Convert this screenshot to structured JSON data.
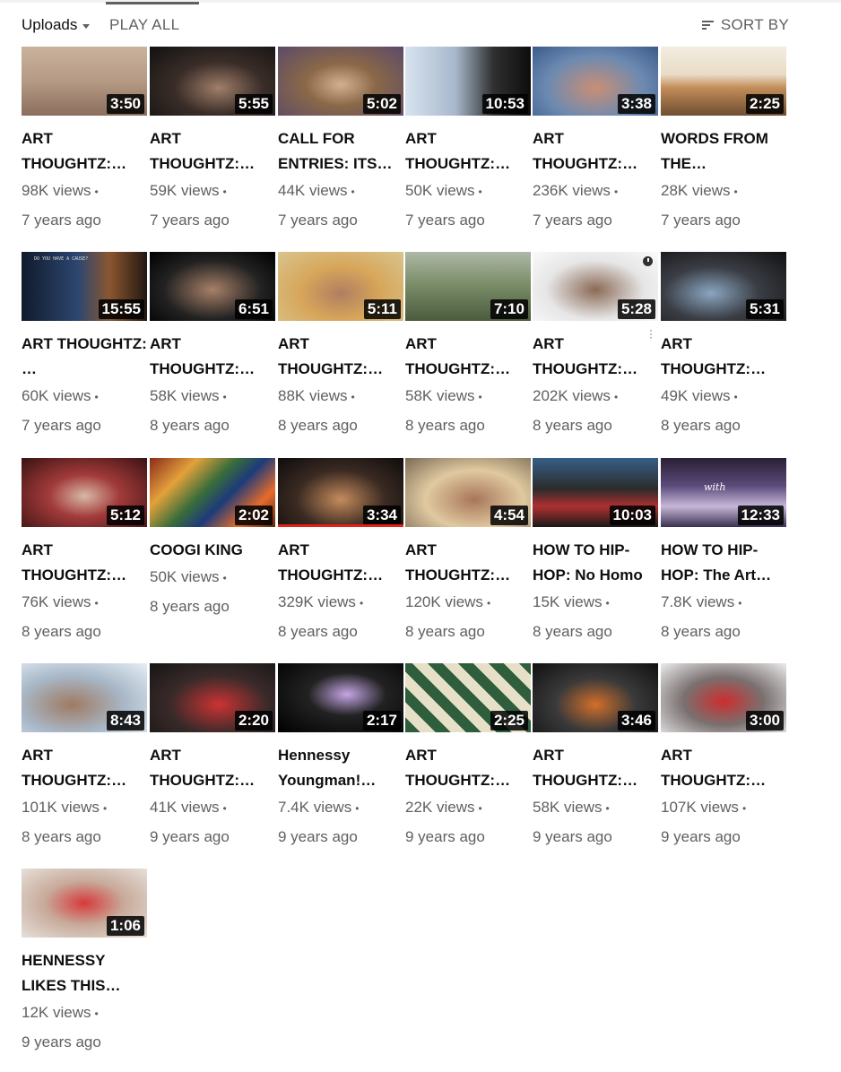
{
  "toolbar": {
    "uploads_label": "Uploads",
    "play_all_label": "PLAY ALL",
    "sort_by_label": "SORT BY"
  },
  "colors": {
    "text": "#0f0f0f",
    "secondary": "#606060",
    "progress": "#e62117"
  },
  "videos": [
    {
      "title": "ART THOUGHTZ:…",
      "duration": "3:50",
      "views": "98K views",
      "age": "7 years ago"
    },
    {
      "title": "ART THOUGHTZ:…",
      "duration": "5:55",
      "views": "59K views",
      "age": "7 years ago"
    },
    {
      "title": "CALL FOR ENTRIES: ITS…",
      "duration": "5:02",
      "views": "44K views",
      "age": "7 years ago"
    },
    {
      "title": "ART THOUGHTZ:…",
      "duration": "10:53",
      "views": "50K views",
      "age": "7 years ago"
    },
    {
      "title": "ART THOUGHTZ:…",
      "duration": "3:38",
      "views": "236K views",
      "age": "7 years ago"
    },
    {
      "title": "WORDS FROM THE…",
      "duration": "2:25",
      "views": "28K views",
      "age": "7 years ago"
    },
    {
      "title": "ART THOUGHTZ: …",
      "duration": "15:55",
      "views": "60K views",
      "age": "7 years ago",
      "thumb_text": "DO YOU HAVE A CAUSE?"
    },
    {
      "title": "ART THOUGHTZ:…",
      "duration": "6:51",
      "views": "58K views",
      "age": "8 years ago"
    },
    {
      "title": "ART THOUGHTZ:…",
      "duration": "5:11",
      "views": "88K views",
      "age": "8 years ago"
    },
    {
      "title": "ART THOUGHTZ:…",
      "duration": "7:10",
      "views": "58K views",
      "age": "8 years ago"
    },
    {
      "title": "ART THOUGHTZ:…",
      "duration": "5:28",
      "views": "202K views",
      "age": "8 years ago"
    },
    {
      "title": "ART THOUGHTZ:…",
      "duration": "5:31",
      "views": "49K views",
      "age": "8 years ago"
    },
    {
      "title": "ART THOUGHTZ:…",
      "duration": "5:12",
      "views": "76K views",
      "age": "8 years ago"
    },
    {
      "title": "COOGI KING",
      "duration": "2:02",
      "views": "50K views",
      "age": "8 years ago"
    },
    {
      "title": "ART THOUGHTZ:…",
      "duration": "3:34",
      "views": "329K views",
      "age": "8 years ago"
    },
    {
      "title": "ART THOUGHTZ:…",
      "duration": "4:54",
      "views": "120K views",
      "age": "8 years ago"
    },
    {
      "title": "HOW TO HIP-HOP: No Homo",
      "duration": "10:03",
      "views": "15K views",
      "age": "8 years ago"
    },
    {
      "title": "HOW TO HIP-HOP: The Art…",
      "duration": "12:33",
      "views": "7.8K views",
      "age": "8 years ago",
      "thumb_text": "with"
    },
    {
      "title": "ART THOUGHTZ:…",
      "duration": "8:43",
      "views": "101K views",
      "age": "8 years ago"
    },
    {
      "title": "ART THOUGHTZ:…",
      "duration": "2:20",
      "views": "41K views",
      "age": "9 years ago"
    },
    {
      "title": "Hennessy Youngman!…",
      "duration": "2:17",
      "views": "7.4K views",
      "age": "9 years ago"
    },
    {
      "title": "ART THOUGHTZ:…",
      "duration": "2:25",
      "views": "22K views",
      "age": "9 years ago"
    },
    {
      "title": "ART THOUGHTZ:…",
      "duration": "3:46",
      "views": "58K views",
      "age": "9 years ago"
    },
    {
      "title": "ART THOUGHTZ:…",
      "duration": "3:00",
      "views": "107K views",
      "age": "9 years ago"
    },
    {
      "title": "HENNESSY LIKES THIS…",
      "duration": "1:06",
      "views": "12K views",
      "age": "9 years ago"
    }
  ]
}
